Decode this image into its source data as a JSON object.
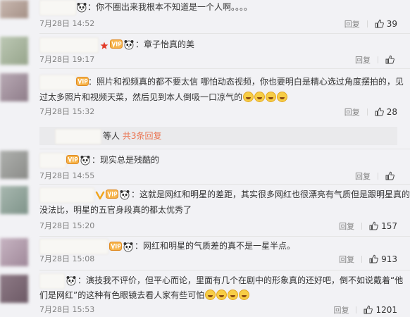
{
  "comments": [
    {
      "text": "：你不圈出来我根本不知道是一个人啊。。。。",
      "time": "7月28日 14:52",
      "reply": "回复",
      "likes": "39",
      "badges": [
        "panda-icon"
      ]
    },
    {
      "text": "：章子怡真的美",
      "time": "7月28日 19:17",
      "reply": "回复",
      "likes": "",
      "badges": [
        "star-red-icon",
        "vip-icon",
        "panda-icon"
      ]
    },
    {
      "text_line1": "：照片和视频真的都不要太信 哪怕动态视频，你也要明白是精心选过角度摆拍的，见",
      "text_line2": "过太多照片和视频天菜，然后见到本人倒吸一口凉气的",
      "time": "7月28日 15:32",
      "reply": "回复",
      "likes": "28",
      "badges": [
        "vip-icon"
      ],
      "sub_reply": {
        "text": "等人",
        "more": "共3条回复"
      }
    },
    {
      "text": "：现实总是残酷的",
      "time": "7月28日 14:55",
      "reply": "回复",
      "likes": "",
      "badges": [
        "vip-icon",
        "panda-icon"
      ]
    },
    {
      "text_line1": "：这就是网红和明星的差距，其实很多网红也很漂亮有气质但是跟明星真的",
      "text_line2": "没法比，明星的五官身段真的都太优秀了",
      "time": "7月28日 15:20",
      "reply": "回复",
      "likes": "157",
      "badges": [
        "v-icon",
        "vip-icon",
        "panda-icon"
      ]
    },
    {
      "text": "：网红和明星的气质差的真不是一星半点。",
      "time": "7月28日 15:08",
      "reply": "回复",
      "likes": "913",
      "badges": [
        "vip-icon",
        "panda-icon"
      ]
    },
    {
      "text_line1": "：演技我不评价，但平心而论，里面有几个在剧中的形象真的还好吧，倒不如说戴着“他",
      "text_line2": "们是网红”的这种有色眼镜去看人家有些可怕",
      "time": "7月28日 15:53",
      "reply": "回复",
      "likes": "1201",
      "badges": [
        "panda-icon"
      ]
    }
  ],
  "colors": {
    "background": "#f2f2f5",
    "time": "#808080",
    "link": "#eb7350"
  }
}
